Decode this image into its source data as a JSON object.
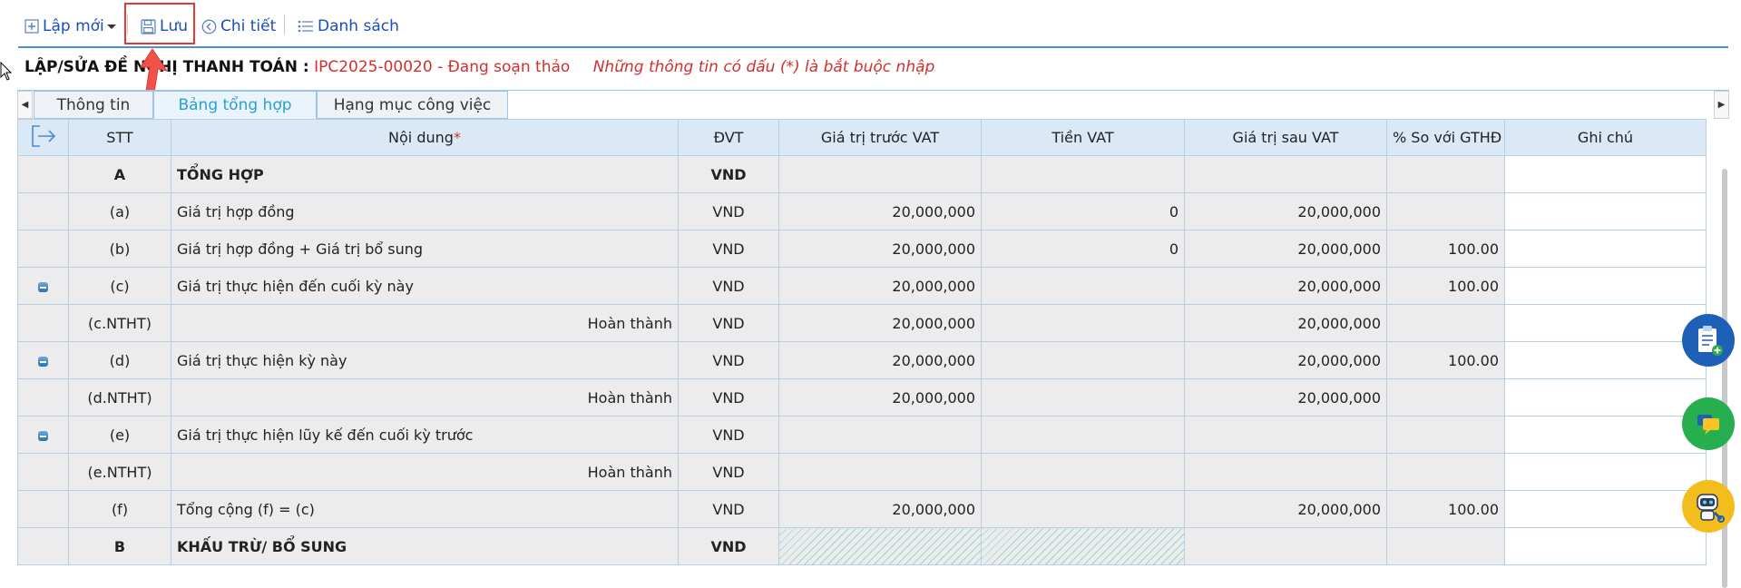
{
  "toolbar": {
    "new_label": "Lập mới",
    "save_label": "Lưu",
    "detail_label": "Chi tiết",
    "list_label": "Danh sách"
  },
  "header": {
    "label": "LẬP/SỬA ĐỀ NGHỊ THANH TOÁN :",
    "code": "IPC2025-00020 - Đang soạn thảo",
    "required_note": "Những thông tin có dấu (*) là bắt buộc nhập"
  },
  "tabs": [
    {
      "label": "Thông tin",
      "active": false
    },
    {
      "label": "Bảng tổng hợp",
      "active": true
    },
    {
      "label": "Hạng mục công việc",
      "active": false
    }
  ],
  "table": {
    "columns": [
      "STT",
      "Nội dung",
      "ĐVT",
      "Giá trị trước VAT",
      "Tiền VAT",
      "Giá trị sau VAT",
      "% So với GTHĐ",
      "Ghi chú"
    ],
    "required_star": "*",
    "rows": [
      {
        "icon": false,
        "stt": "A",
        "content": "TỔNG HỢP",
        "unit": "VND",
        "pre_vat": "",
        "vat": "",
        "post_vat": "",
        "pct": "",
        "note": "",
        "bold": true,
        "indent": false
      },
      {
        "icon": false,
        "stt": "(a)",
        "content": "Giá trị hợp đồng",
        "unit": "VND",
        "pre_vat": "20,000,000",
        "vat": "0",
        "post_vat": "20,000,000",
        "pct": "",
        "note": "",
        "bold": false,
        "indent": false
      },
      {
        "icon": false,
        "stt": "(b)",
        "content": "Giá trị hợp đồng + Giá trị bổ sung",
        "unit": "VND",
        "pre_vat": "20,000,000",
        "vat": "0",
        "post_vat": "20,000,000",
        "pct": "100.00",
        "note": "",
        "bold": false,
        "indent": false
      },
      {
        "icon": true,
        "stt": "(c)",
        "content": "Giá trị thực hiện đến cuối kỳ này",
        "unit": "VND",
        "pre_vat": "20,000,000",
        "vat": "",
        "post_vat": "20,000,000",
        "pct": "100.00",
        "note": "",
        "bold": false,
        "indent": false
      },
      {
        "icon": false,
        "stt": "(c.NTHT)",
        "content": "Hoàn thành",
        "unit": "VND",
        "pre_vat": "20,000,000",
        "vat": "",
        "post_vat": "20,000,000",
        "pct": "",
        "note": "",
        "bold": false,
        "indent": true
      },
      {
        "icon": true,
        "stt": "(d)",
        "content": "Giá trị thực hiện kỳ này",
        "unit": "VND",
        "pre_vat": "20,000,000",
        "vat": "",
        "post_vat": "20,000,000",
        "pct": "100.00",
        "note": "",
        "bold": false,
        "indent": false
      },
      {
        "icon": false,
        "stt": "(d.NTHT)",
        "content": "Hoàn thành",
        "unit": "VND",
        "pre_vat": "20,000,000",
        "vat": "",
        "post_vat": "20,000,000",
        "pct": "",
        "note": "",
        "bold": false,
        "indent": true
      },
      {
        "icon": true,
        "stt": "(e)",
        "content": "Giá trị thực hiện lũy kế đến cuối kỳ trước",
        "unit": "VND",
        "pre_vat": "",
        "vat": "",
        "post_vat": "",
        "pct": "",
        "note": "",
        "bold": false,
        "indent": false
      },
      {
        "icon": false,
        "stt": "(e.NTHT)",
        "content": "Hoàn thành",
        "unit": "VND",
        "pre_vat": "",
        "vat": "",
        "post_vat": "",
        "pct": "",
        "note": "",
        "bold": false,
        "indent": true
      },
      {
        "icon": false,
        "stt": "(f)",
        "content": "Tổng cộng (f) = (c)",
        "unit": "VND",
        "pre_vat": "20,000,000",
        "vat": "",
        "post_vat": "20,000,000",
        "pct": "100.00",
        "note": "",
        "bold": false,
        "indent": false
      },
      {
        "icon": false,
        "stt": "B",
        "content": "KHẤU TRỪ/ BỔ SUNG",
        "unit": "VND",
        "pre_vat": "",
        "vat": "",
        "post_vat": "",
        "pct": "",
        "note": "",
        "bold": true,
        "indent": false
      }
    ]
  },
  "colors": {
    "link_blue": "#1a4fb5",
    "required_red": "#d32f2f",
    "header_bg": "#dbe9f7",
    "active_tab": "#2a9fd6"
  },
  "icons": [
    "add-icon",
    "save-icon",
    "back-circle-icon",
    "list-icon",
    "export-icon",
    "row-collapse-icon",
    "clipboard-add-icon",
    "chat-icon",
    "robot-support-icon"
  ]
}
